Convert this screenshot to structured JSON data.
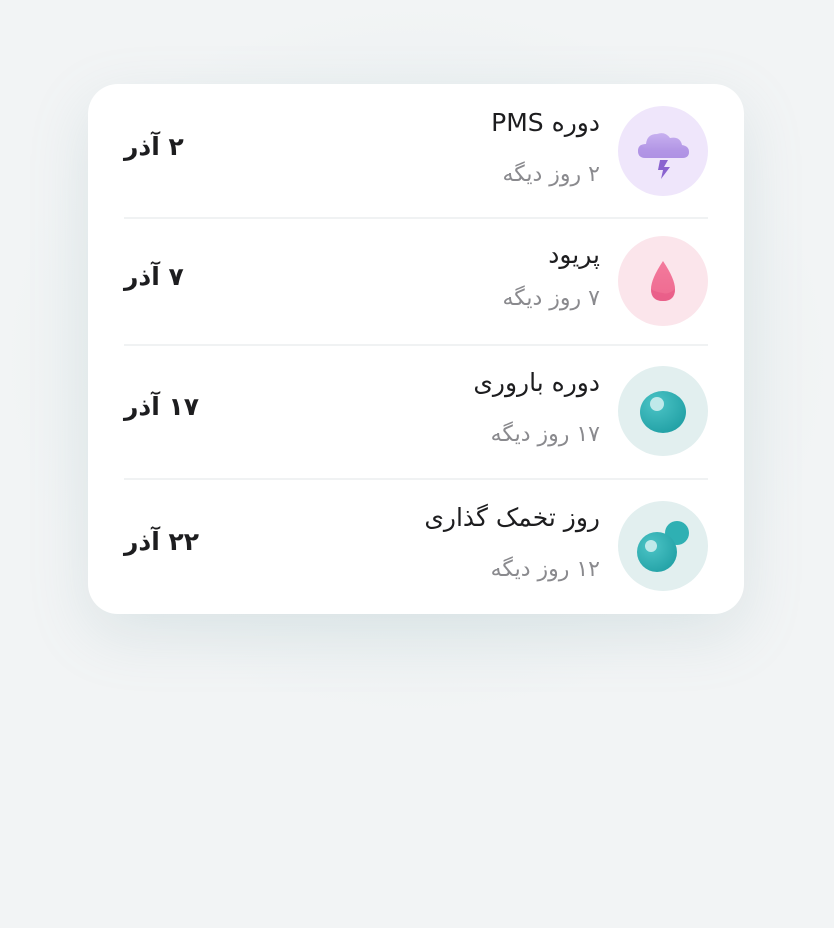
{
  "events": [
    {
      "icon": "storm-cloud-icon",
      "title": "دوره PMS",
      "countdown": "۲ روز دیگه",
      "date": "۲ آذر",
      "icon_bg": "#efe6fb",
      "accent": "#9d7fd9"
    },
    {
      "icon": "blood-drop-icon",
      "title": "پریود",
      "countdown": "۷ روز دیگه",
      "date": "۷ آذر",
      "icon_bg": "#fbe5eb",
      "accent": "#ec5d84"
    },
    {
      "icon": "egg-cell-icon",
      "title": "دوره باروری",
      "countdown": "۱۷ روز دیگه",
      "date": "۱۷ آذر",
      "icon_bg": "#e2efef",
      "accent": "#2ba9ad"
    },
    {
      "icon": "ovulation-cell-icon",
      "title": "روز تخمک گذاری",
      "countdown": "۱۲ روز دیگه",
      "date": "۲۲ آذر",
      "icon_bg": "#e2efef",
      "accent": "#2ba9ad"
    }
  ]
}
